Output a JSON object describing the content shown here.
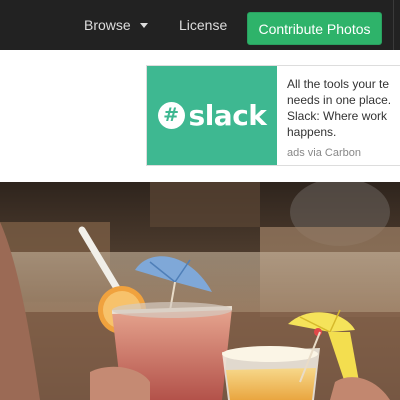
{
  "nav": {
    "browse_label": "Browse",
    "license_label": "License",
    "contribute_label": "Contribute Photos"
  },
  "ad": {
    "logo_text": "slack",
    "text": "All the tools your te\nneeds in one place.\nSlack: Where work\nhappens.",
    "via": "ads via Carbon"
  },
  "colors": {
    "nav_bg": "#222222",
    "accent": "#2eb36a",
    "ad_bg": "#3eb891"
  }
}
